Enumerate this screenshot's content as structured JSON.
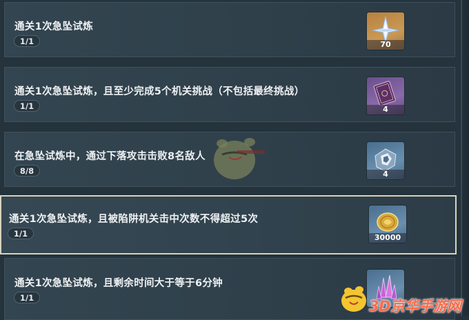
{
  "challenges": [
    {
      "title": "通关1次急坠试炼",
      "progress": "1/1",
      "reward": {
        "icon": "primogem-icon",
        "qty": "70"
      }
    },
    {
      "title": "通关1次急坠试炼，且至少完成5个机关挑战（不包括最终挑战）",
      "progress": "1/1",
      "reward": {
        "icon": "heros-wit-book-icon",
        "qty": "4"
      }
    },
    {
      "title": "在急坠试炼中，通过下落攻击击败8名敌人",
      "progress": "8/8",
      "reward": {
        "icon": "mystic-enhancement-ore-icon",
        "qty": "4"
      }
    },
    {
      "title": "通关1次急坠试炼，且被陷阱机关击中次数不得超过5次",
      "progress": "1/1",
      "reward": {
        "icon": "mora-coin-icon",
        "qty": "30000"
      }
    },
    {
      "title": "通关1次急坠试炼，且剩余时间大于等于6分钟",
      "progress": "1/1",
      "reward": {
        "icon": "crystal-icon",
        "qty": ""
      }
    }
  ],
  "watermark": {
    "site": "3D京华手游网",
    "colors": {
      "accent": "#ff6b4a"
    }
  },
  "colors": {
    "background": "#24333c",
    "row": "#334550",
    "highlight_border": "#d9d2bd"
  }
}
